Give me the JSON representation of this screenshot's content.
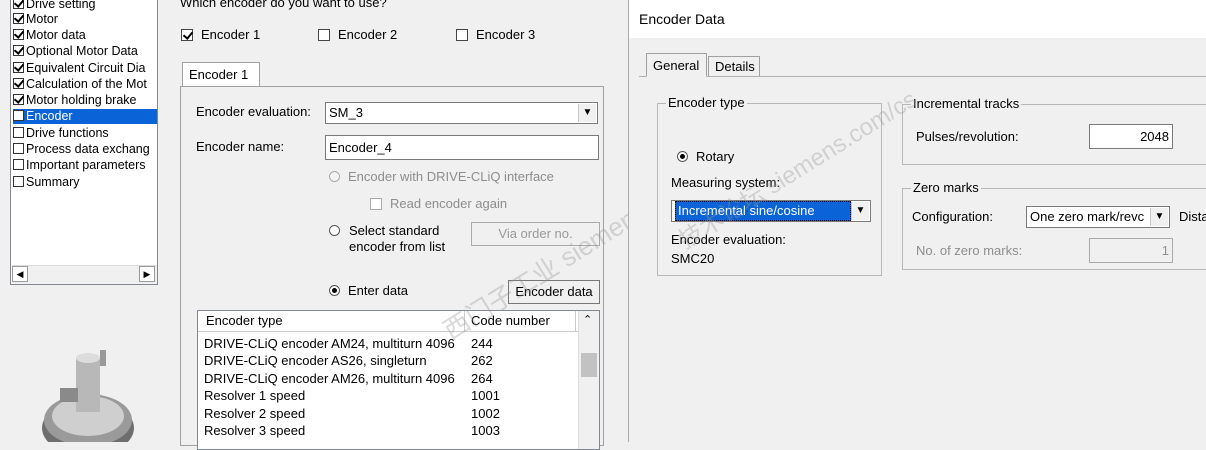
{
  "tree": {
    "items": [
      {
        "label": "Drive setting",
        "checked": true
      },
      {
        "label": "Motor",
        "checked": true
      },
      {
        "label": "Motor data",
        "checked": true
      },
      {
        "label": "Optional Motor Data",
        "checked": true
      },
      {
        "label": "Equivalent Circuit Dia",
        "checked": true
      },
      {
        "label": "Calculation of the Mot",
        "checked": true
      },
      {
        "label": "Motor holding brake",
        "checked": true
      },
      {
        "label": "Encoder",
        "checked": false,
        "selected": true
      },
      {
        "label": "Drive functions",
        "checked": false
      },
      {
        "label": "Process data exchanɡ",
        "checked": false
      },
      {
        "label": "Important parameters",
        "checked": false
      },
      {
        "label": "Summary",
        "checked": false
      }
    ]
  },
  "wizard": {
    "question": "Which encoder do you want to use?",
    "encoders": [
      "Encoder 1",
      "Encoder 2",
      "Encoder 3"
    ],
    "tab": "Encoder 1",
    "eval_label": "Encoder evaluation:",
    "eval_value": "SM_3",
    "name_label": "Encoder name:",
    "name_value": "Encoder_4",
    "opt_driveclick": "Encoder with DRIVE-CLiQ interface",
    "opt_read_again": "Read encoder again",
    "opt_standard_1": "Select standard",
    "opt_standard_2": "encoder from list",
    "via_order_btn": "Via order no.",
    "opt_enter": "Enter data",
    "enc_data_btn": "Encoder data",
    "list": {
      "col_type": "Encoder type",
      "col_code": "Code number",
      "rows": [
        {
          "type": "DRIVE-CLiQ encoder AM24, multiturn 4096",
          "code": "244"
        },
        {
          "type": "DRIVE-CLiQ encoder AS26, singleturn",
          "code": "262"
        },
        {
          "type": "DRIVE-CLiQ encoder AM26, multiturn 4096",
          "code": "264"
        },
        {
          "type": "Resolver 1 speed",
          "code": "1001"
        },
        {
          "type": "Resolver 2 speed",
          "code": "1002"
        },
        {
          "type": "Resolver 3 speed",
          "code": "1003"
        }
      ]
    }
  },
  "dialog": {
    "title": "Encoder Data",
    "tabs": [
      "General",
      "Details"
    ],
    "encoder_type_group": "Encoder type",
    "rotary": "Rotary",
    "measuring_label": "Measuring system:",
    "measuring_value": "Incremental sine/cosine",
    "eval_label": "Encoder evaluation:",
    "eval_value": "SMC20",
    "inc_group": "Incremental tracks",
    "pulses_label": "Pulses/revolution:",
    "pulses_value": "2048",
    "zero_group": "Zero marks",
    "config_label": "Configuration:",
    "config_value": "One zero mark/revc",
    "dist_label": "Dista",
    "num_zero_label": "No. of zero marks:",
    "num_zero_value": "1"
  },
  "colors": {
    "selection": "#0a64d8",
    "window": "#f0f0f0"
  }
}
